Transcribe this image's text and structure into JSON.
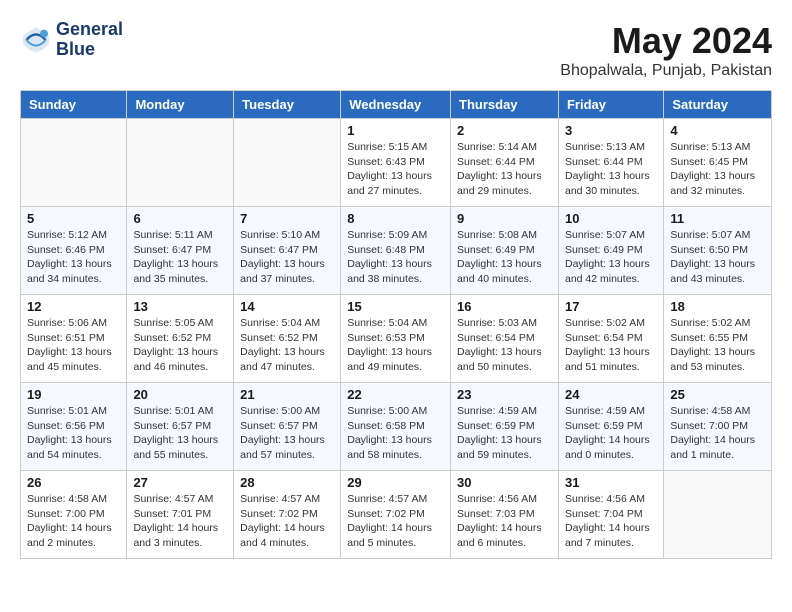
{
  "header": {
    "logo_line1": "General",
    "logo_line2": "Blue",
    "month": "May 2024",
    "location": "Bhopalwala, Punjab, Pakistan"
  },
  "days_of_week": [
    "Sunday",
    "Monday",
    "Tuesday",
    "Wednesday",
    "Thursday",
    "Friday",
    "Saturday"
  ],
  "weeks": [
    [
      {
        "day": "",
        "info": ""
      },
      {
        "day": "",
        "info": ""
      },
      {
        "day": "",
        "info": ""
      },
      {
        "day": "1",
        "info": "Sunrise: 5:15 AM\nSunset: 6:43 PM\nDaylight: 13 hours\nand 27 minutes."
      },
      {
        "day": "2",
        "info": "Sunrise: 5:14 AM\nSunset: 6:44 PM\nDaylight: 13 hours\nand 29 minutes."
      },
      {
        "day": "3",
        "info": "Sunrise: 5:13 AM\nSunset: 6:44 PM\nDaylight: 13 hours\nand 30 minutes."
      },
      {
        "day": "4",
        "info": "Sunrise: 5:13 AM\nSunset: 6:45 PM\nDaylight: 13 hours\nand 32 minutes."
      }
    ],
    [
      {
        "day": "5",
        "info": "Sunrise: 5:12 AM\nSunset: 6:46 PM\nDaylight: 13 hours\nand 34 minutes."
      },
      {
        "day": "6",
        "info": "Sunrise: 5:11 AM\nSunset: 6:47 PM\nDaylight: 13 hours\nand 35 minutes."
      },
      {
        "day": "7",
        "info": "Sunrise: 5:10 AM\nSunset: 6:47 PM\nDaylight: 13 hours\nand 37 minutes."
      },
      {
        "day": "8",
        "info": "Sunrise: 5:09 AM\nSunset: 6:48 PM\nDaylight: 13 hours\nand 38 minutes."
      },
      {
        "day": "9",
        "info": "Sunrise: 5:08 AM\nSunset: 6:49 PM\nDaylight: 13 hours\nand 40 minutes."
      },
      {
        "day": "10",
        "info": "Sunrise: 5:07 AM\nSunset: 6:49 PM\nDaylight: 13 hours\nand 42 minutes."
      },
      {
        "day": "11",
        "info": "Sunrise: 5:07 AM\nSunset: 6:50 PM\nDaylight: 13 hours\nand 43 minutes."
      }
    ],
    [
      {
        "day": "12",
        "info": "Sunrise: 5:06 AM\nSunset: 6:51 PM\nDaylight: 13 hours\nand 45 minutes."
      },
      {
        "day": "13",
        "info": "Sunrise: 5:05 AM\nSunset: 6:52 PM\nDaylight: 13 hours\nand 46 minutes."
      },
      {
        "day": "14",
        "info": "Sunrise: 5:04 AM\nSunset: 6:52 PM\nDaylight: 13 hours\nand 47 minutes."
      },
      {
        "day": "15",
        "info": "Sunrise: 5:04 AM\nSunset: 6:53 PM\nDaylight: 13 hours\nand 49 minutes."
      },
      {
        "day": "16",
        "info": "Sunrise: 5:03 AM\nSunset: 6:54 PM\nDaylight: 13 hours\nand 50 minutes."
      },
      {
        "day": "17",
        "info": "Sunrise: 5:02 AM\nSunset: 6:54 PM\nDaylight: 13 hours\nand 51 minutes."
      },
      {
        "day": "18",
        "info": "Sunrise: 5:02 AM\nSunset: 6:55 PM\nDaylight: 13 hours\nand 53 minutes."
      }
    ],
    [
      {
        "day": "19",
        "info": "Sunrise: 5:01 AM\nSunset: 6:56 PM\nDaylight: 13 hours\nand 54 minutes."
      },
      {
        "day": "20",
        "info": "Sunrise: 5:01 AM\nSunset: 6:57 PM\nDaylight: 13 hours\nand 55 minutes."
      },
      {
        "day": "21",
        "info": "Sunrise: 5:00 AM\nSunset: 6:57 PM\nDaylight: 13 hours\nand 57 minutes."
      },
      {
        "day": "22",
        "info": "Sunrise: 5:00 AM\nSunset: 6:58 PM\nDaylight: 13 hours\nand 58 minutes."
      },
      {
        "day": "23",
        "info": "Sunrise: 4:59 AM\nSunset: 6:59 PM\nDaylight: 13 hours\nand 59 minutes."
      },
      {
        "day": "24",
        "info": "Sunrise: 4:59 AM\nSunset: 6:59 PM\nDaylight: 14 hours\nand 0 minutes."
      },
      {
        "day": "25",
        "info": "Sunrise: 4:58 AM\nSunset: 7:00 PM\nDaylight: 14 hours\nand 1 minute."
      }
    ],
    [
      {
        "day": "26",
        "info": "Sunrise: 4:58 AM\nSunset: 7:00 PM\nDaylight: 14 hours\nand 2 minutes."
      },
      {
        "day": "27",
        "info": "Sunrise: 4:57 AM\nSunset: 7:01 PM\nDaylight: 14 hours\nand 3 minutes."
      },
      {
        "day": "28",
        "info": "Sunrise: 4:57 AM\nSunset: 7:02 PM\nDaylight: 14 hours\nand 4 minutes."
      },
      {
        "day": "29",
        "info": "Sunrise: 4:57 AM\nSunset: 7:02 PM\nDaylight: 14 hours\nand 5 minutes."
      },
      {
        "day": "30",
        "info": "Sunrise: 4:56 AM\nSunset: 7:03 PM\nDaylight: 14 hours\nand 6 minutes."
      },
      {
        "day": "31",
        "info": "Sunrise: 4:56 AM\nSunset: 7:04 PM\nDaylight: 14 hours\nand 7 minutes."
      },
      {
        "day": "",
        "info": ""
      }
    ]
  ]
}
